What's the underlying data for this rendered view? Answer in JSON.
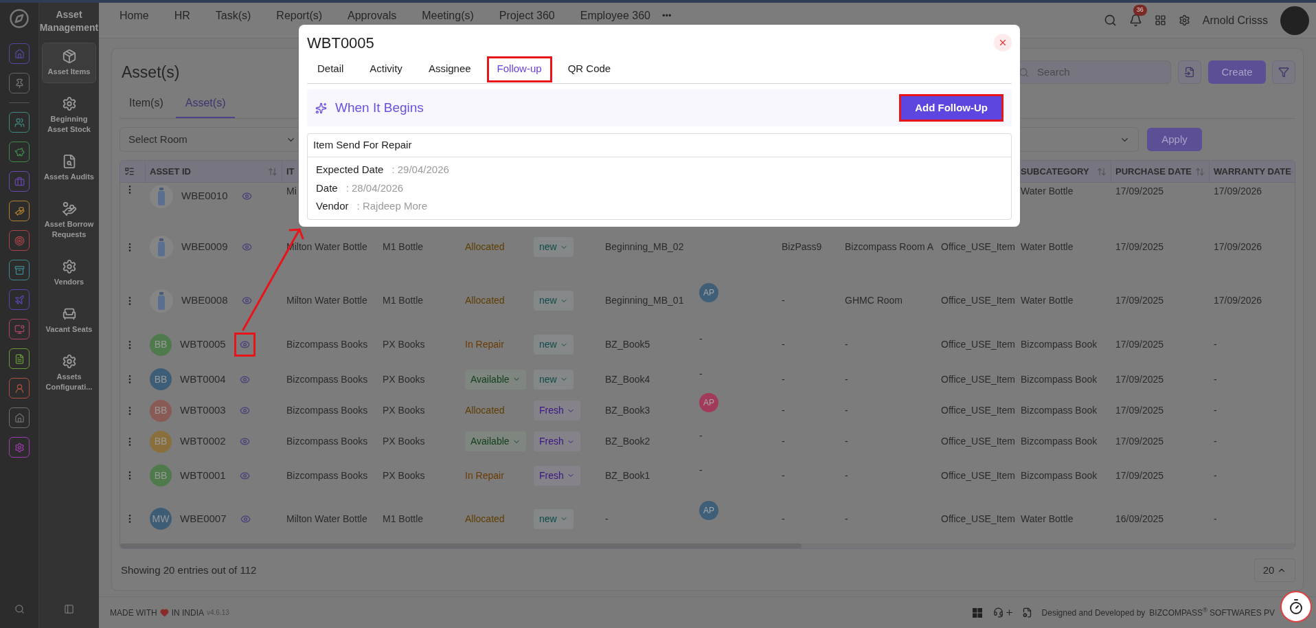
{
  "app": {
    "title": "Asset Management"
  },
  "sidebar": {
    "items": [
      {
        "label": "Asset Items",
        "kind": "package",
        "selected": true
      },
      {
        "label": "Beginning Asset Stock",
        "kind": "gear",
        "selected": false
      },
      {
        "label": "Assets Audits",
        "kind": "audit",
        "selected": false
      },
      {
        "label": "Asset Borrow Requests",
        "kind": "borrow",
        "selected": false
      },
      {
        "label": "Vendors",
        "kind": "gear",
        "selected": false
      },
      {
        "label": "Vacant Seats",
        "kind": "seat",
        "selected": false
      },
      {
        "label": "Assets Configurati...",
        "kind": "gear",
        "selected": false
      }
    ]
  },
  "nav": {
    "items": [
      "Home",
      "HR",
      "Task(s)",
      "Report(s)",
      "Approvals",
      "Meeting(s)",
      "Project 360",
      "Employee 360"
    ],
    "more": "•••",
    "notifications": "36",
    "user_name": "Arnold Crisss"
  },
  "page": {
    "title": "Asset(s)",
    "tabs": [
      {
        "label": "Item(s)",
        "selected": false
      },
      {
        "label": "Asset(s)",
        "selected": true
      }
    ],
    "search": {
      "placeholder": "Search"
    },
    "create": "Create",
    "room_select": {
      "placeholder": "Select Room"
    },
    "apply": "Apply"
  },
  "table": {
    "columns": {
      "asset_id": "ASSET ID",
      "column_3": "IT",
      "subcategory": "SUBCATEGORY",
      "purchase_date": "PURCHASE DATE",
      "warranty_date": "WARRANTY DATE"
    },
    "rows": [
      {
        "highlighted": false,
        "avatar": {
          "kind": "image"
        },
        "asset_id": "WBE0010",
        "column_3": "Mi",
        "subcategory": "Water Bottle",
        "purchase_date": "17/09/2025",
        "warranty_date": "17/09/2026"
      },
      {
        "highlighted": false,
        "avatar": {
          "kind": "image"
        },
        "asset_id": "WBE0009",
        "column_3": "Milton Water Bottle",
        "column_4": "M1 Bottle",
        "column_5": {
          "label": "Allocated",
          "kind": "allocated"
        },
        "column_6": {
          "label": "new",
          "kind": "new"
        },
        "column_7": "Beginning_MB_02",
        "column_9": "BizPass9",
        "column_10": "Bizcompass Room A",
        "column_11": "Office_USE_Item",
        "subcategory": "Water Bottle",
        "purchase_date": "17/09/2025",
        "warranty_date": "17/09/2026"
      },
      {
        "highlighted": false,
        "avatar": {
          "kind": "image"
        },
        "asset_id": "WBE0008",
        "column_3": "Milton Water Bottle",
        "column_4": "M1 Bottle",
        "column_5": {
          "label": "Allocated",
          "kind": "allocated"
        },
        "column_6": {
          "label": "new",
          "kind": "new"
        },
        "column_7": "Beginning_MB_01",
        "column_8": {
          "kind": "avatar",
          "text": "AP",
          "color": "#3f5f78"
        },
        "column_9": "-",
        "column_10": "GHMC Room",
        "column_11": "Office_USE_Item",
        "subcategory": "Water Bottle",
        "purchase_date": "17/09/2025",
        "warranty_date": "17/09/2026"
      },
      {
        "highlighted": true,
        "avatar": {
          "kind": "initials",
          "text": "BB",
          "color": "#4f7a4c"
        },
        "asset_id": "WBT0005",
        "column_3": "Bizcompass Books",
        "column_4": "PX Books",
        "column_5": {
          "label": "In Repair",
          "kind": "in_repair"
        },
        "column_6": {
          "label": "new",
          "kind": "new"
        },
        "column_7": "BZ_Book5",
        "column_8": {
          "kind": "text",
          "text": "-"
        },
        "column_9": "-",
        "column_10": "-",
        "column_11": "Office_USE_Item",
        "subcategory": "Bizcompass Book",
        "purchase_date": "17/09/2025",
        "warranty_date": "-"
      },
      {
        "highlighted": false,
        "avatar": {
          "kind": "initials",
          "text": "BB",
          "color": "#3d5d76"
        },
        "asset_id": "WBT0004",
        "column_3": "Bizcompass Books",
        "column_4": "PX Books",
        "column_5": {
          "label": "Available",
          "kind": "available"
        },
        "column_6": {
          "label": "new",
          "kind": "new"
        },
        "column_7": "BZ_Book4",
        "column_8": {
          "kind": "text",
          "text": "-"
        },
        "column_9": "-",
        "column_10": "-",
        "column_11": "Office_USE_Item",
        "subcategory": "Bizcompass Book",
        "purchase_date": "17/09/2025",
        "warranty_date": "-"
      },
      {
        "highlighted": false,
        "avatar": {
          "kind": "initials",
          "text": "BB",
          "color": "#8a5a55"
        },
        "asset_id": "WBT0003",
        "column_3": "Bizcompass Books",
        "column_4": "PX Books",
        "column_5": {
          "label": "Allocated",
          "kind": "allocated"
        },
        "column_6": {
          "label": "Fresh",
          "kind": "fresh"
        },
        "column_7": "BZ_Book3",
        "column_8": {
          "kind": "avatar",
          "text": "AP",
          "color": "#a23a5a"
        },
        "column_9": "-",
        "column_10": "-",
        "column_11": "Office_USE_Item",
        "subcategory": "Bizcompass Book",
        "purchase_date": "17/09/2025",
        "warranty_date": "-"
      },
      {
        "highlighted": false,
        "avatar": {
          "kind": "initials",
          "text": "BB",
          "color": "#8a6f3c"
        },
        "asset_id": "WBT0002",
        "column_3": "Bizcompass Books",
        "column_4": "PX Books",
        "column_5": {
          "label": "Available",
          "kind": "available"
        },
        "column_6": {
          "label": "Fresh",
          "kind": "fresh"
        },
        "column_7": "BZ_Book2",
        "column_8": {
          "kind": "text",
          "text": "-"
        },
        "column_9": "-",
        "column_10": "-",
        "column_11": "Office_USE_Item",
        "subcategory": "Bizcompass Book",
        "purchase_date": "17/09/2025",
        "warranty_date": "-"
      },
      {
        "highlighted": false,
        "avatar": {
          "kind": "initials",
          "text": "BB",
          "color": "#4f7a4c"
        },
        "asset_id": "WBT0001",
        "column_3": "Bizcompass Books",
        "column_4": "PX Books",
        "column_5": {
          "label": "In Repair",
          "kind": "in_repair"
        },
        "column_6": {
          "label": "Fresh",
          "kind": "fresh"
        },
        "column_7": "BZ_Book1",
        "column_8": {
          "kind": "text",
          "text": "-"
        },
        "column_9": "-",
        "column_10": "-",
        "column_11": "Office_USE_Item",
        "subcategory": "Bizcompass Book",
        "purchase_date": "17/09/2025",
        "warranty_date": "-"
      },
      {
        "highlighted": false,
        "avatar": {
          "kind": "initials",
          "text": "MW",
          "color": "#3d5d76"
        },
        "asset_id": "WBE0007",
        "column_3": "Milton Water Bottle",
        "column_4": "M1 Bottle",
        "column_5": {
          "label": "Allocated",
          "kind": "allocated"
        },
        "column_6": {
          "label": "new",
          "kind": "new"
        },
        "column_7": "-",
        "column_8": {
          "kind": "avatar",
          "text": "AP",
          "color": "#3f5f78"
        },
        "column_9": "-",
        "column_10": "-",
        "column_11": "Office_USE_Item",
        "subcategory": "Water Bottle",
        "purchase_date": "16/09/2025",
        "warranty_date": "-"
      }
    ],
    "summary": "Showing 20 entries out of 112",
    "page_size": "20"
  },
  "footer": {
    "made_with": "MADE WITH",
    "in_india": "IN INDIA",
    "version": "v4.6.13",
    "credit": "Designed and Developed by",
    "brand": "BIZCOMPASS$^{®}$ SOFTWARES PV"
  },
  "modal": {
    "title": "WBT0005",
    "tabs": [
      {
        "label": "Detail",
        "selected": false,
        "highlighted": false
      },
      {
        "label": "Activity",
        "selected": false,
        "highlighted": false
      },
      {
        "label": "Assignee",
        "selected": false,
        "highlighted": false
      },
      {
        "label": "Follow-up",
        "selected": true,
        "highlighted": true
      },
      {
        "label": "QR Code",
        "selected": false,
        "highlighted": false
      }
    ],
    "section_title": "When It Begins",
    "add_button": {
      "label": "Add Follow-Up",
      "highlighted": true
    },
    "follow_up": {
      "title": "Item Send For Repair",
      "fields": [
        {
          "label": "Expected Date",
          "value": ": 29/04/2026"
        },
        {
          "label": "Date",
          "value": ": 28/04/2026"
        },
        {
          "label": "Vendor",
          "value": ": Rajdeep More"
        }
      ]
    }
  }
}
